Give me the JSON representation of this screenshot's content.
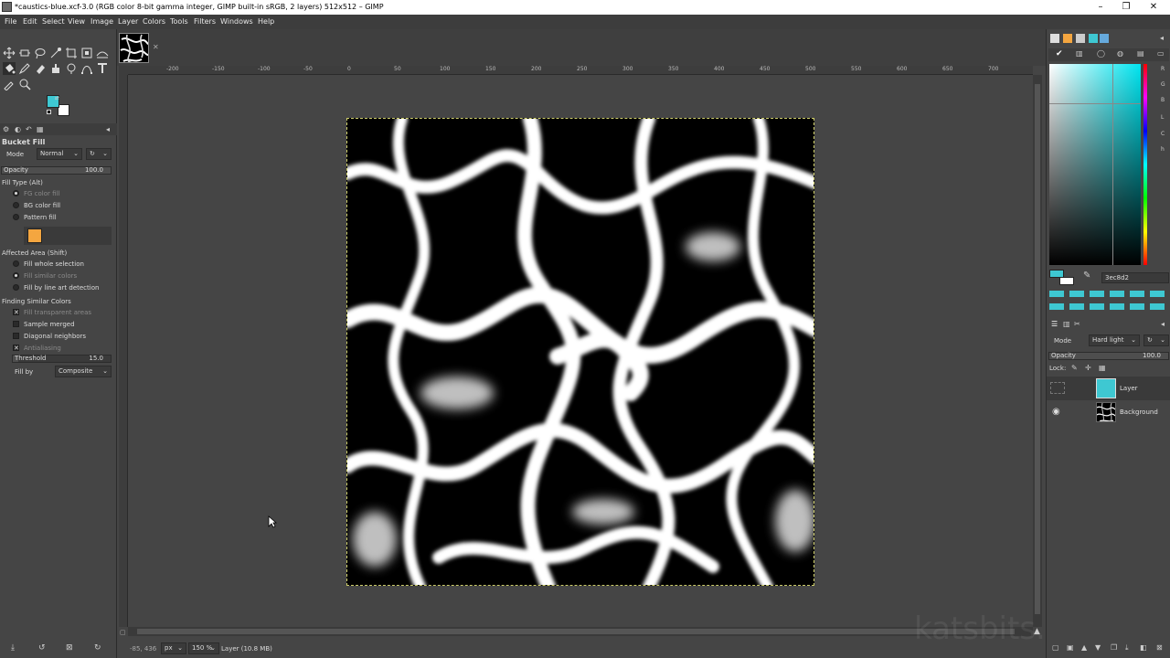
{
  "window": {
    "title": "*caustics-blue.xcf-3.0 (RGB color 8-bit gamma integer, GIMP built-in sRGB, 2 layers) 512x512 – GIMP",
    "controls": {
      "minimize": "–",
      "maximize": "❐",
      "close": "✕"
    }
  },
  "menu": [
    "File",
    "Edit",
    "Select",
    "View",
    "Image",
    "Layer",
    "Colors",
    "Tools",
    "Filters",
    "Windows",
    "Help"
  ],
  "tool_options": {
    "title": "Bucket Fill",
    "mode_label": "Mode",
    "mode_value": "Normal",
    "opacity_label": "Opacity",
    "opacity_value": "100.0",
    "fill_type_label": "Fill Type  (Alt)",
    "fill_types": [
      "FG color fill",
      "BG color fill",
      "Pattern fill"
    ],
    "affected_area_label": "Affected Area  (Shift)",
    "affected_areas": [
      "Fill whole selection",
      "Fill similar colors",
      "Fill by line art detection"
    ],
    "finding_label": "Finding Similar Colors",
    "finding_options": [
      "Fill transparent areas",
      "Sample merged",
      "Diagonal neighbors",
      "Antialiasing"
    ],
    "threshold_label": "Threshold",
    "threshold_value": "15.0",
    "fill_by_label": "Fill by",
    "fill_by_value": "Composite"
  },
  "colors": {
    "foreground": "#3ec8d2",
    "background": "#ffffff",
    "pattern_swatch": "#f4a640",
    "hex_value": "3ec8d2"
  },
  "ruler": {
    "h_ticks": [
      "-200",
      "-150",
      "-100",
      "-50",
      "0",
      "50",
      "100",
      "150",
      "200",
      "250",
      "300",
      "350",
      "400",
      "450",
      "500",
      "550",
      "600",
      "650",
      "700"
    ]
  },
  "statusbar": {
    "coords": "-85, 436",
    "unit": "px",
    "zoom": "150 %",
    "layer_info": "Layer (10.8 MB)"
  },
  "layers": {
    "mode_label": "Mode",
    "mode_value": "Hard light",
    "opacity_label": "Opacity",
    "opacity_value": "100.0",
    "lock_label": "Lock:",
    "items": [
      {
        "name": "Layer",
        "visible": false,
        "thumb_color": "#3ec8d2"
      },
      {
        "name": "Background",
        "visible": true,
        "thumb_color": "#000000"
      }
    ]
  },
  "watermark": "katsbits.com"
}
